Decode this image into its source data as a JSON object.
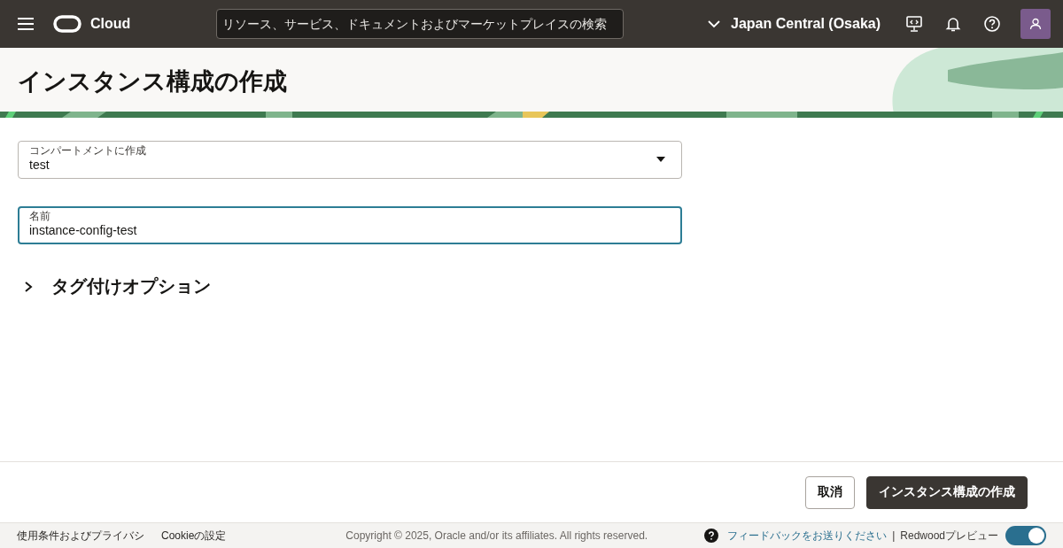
{
  "header": {
    "brand": "Cloud",
    "search": {
      "placeholder": "リソース、サービス、ドキュメントおよびマーケットプレイスの検索"
    },
    "region": "Japan Central (Osaka)"
  },
  "page_title": "インスタンス構成の作成",
  "fields": [
    {
      "kind": "select",
      "label": "コンパートメントに作成",
      "value": "test",
      "focused": false
    },
    {
      "kind": "text",
      "label": "名前",
      "value": "instance-config-test",
      "focused": true
    }
  ],
  "section": {
    "label": "タグ付けオプション",
    "expanded": false
  },
  "actions": [
    {
      "label": "取消",
      "primary": false
    },
    {
      "label": "インスタンス構成の作成",
      "primary": true
    }
  ],
  "footer": {
    "links": [
      "使用条件およびプライバシ",
      "Cookieの設定"
    ],
    "copyright": "Copyright © 2025, Oracle and/or its affiliates. All rights reserved.",
    "feedback": "フィードバックをお送りください",
    "separator": "|",
    "preview_label": "Redwoodプレビュー",
    "preview_toggle": {
      "on": true
    }
  }
}
